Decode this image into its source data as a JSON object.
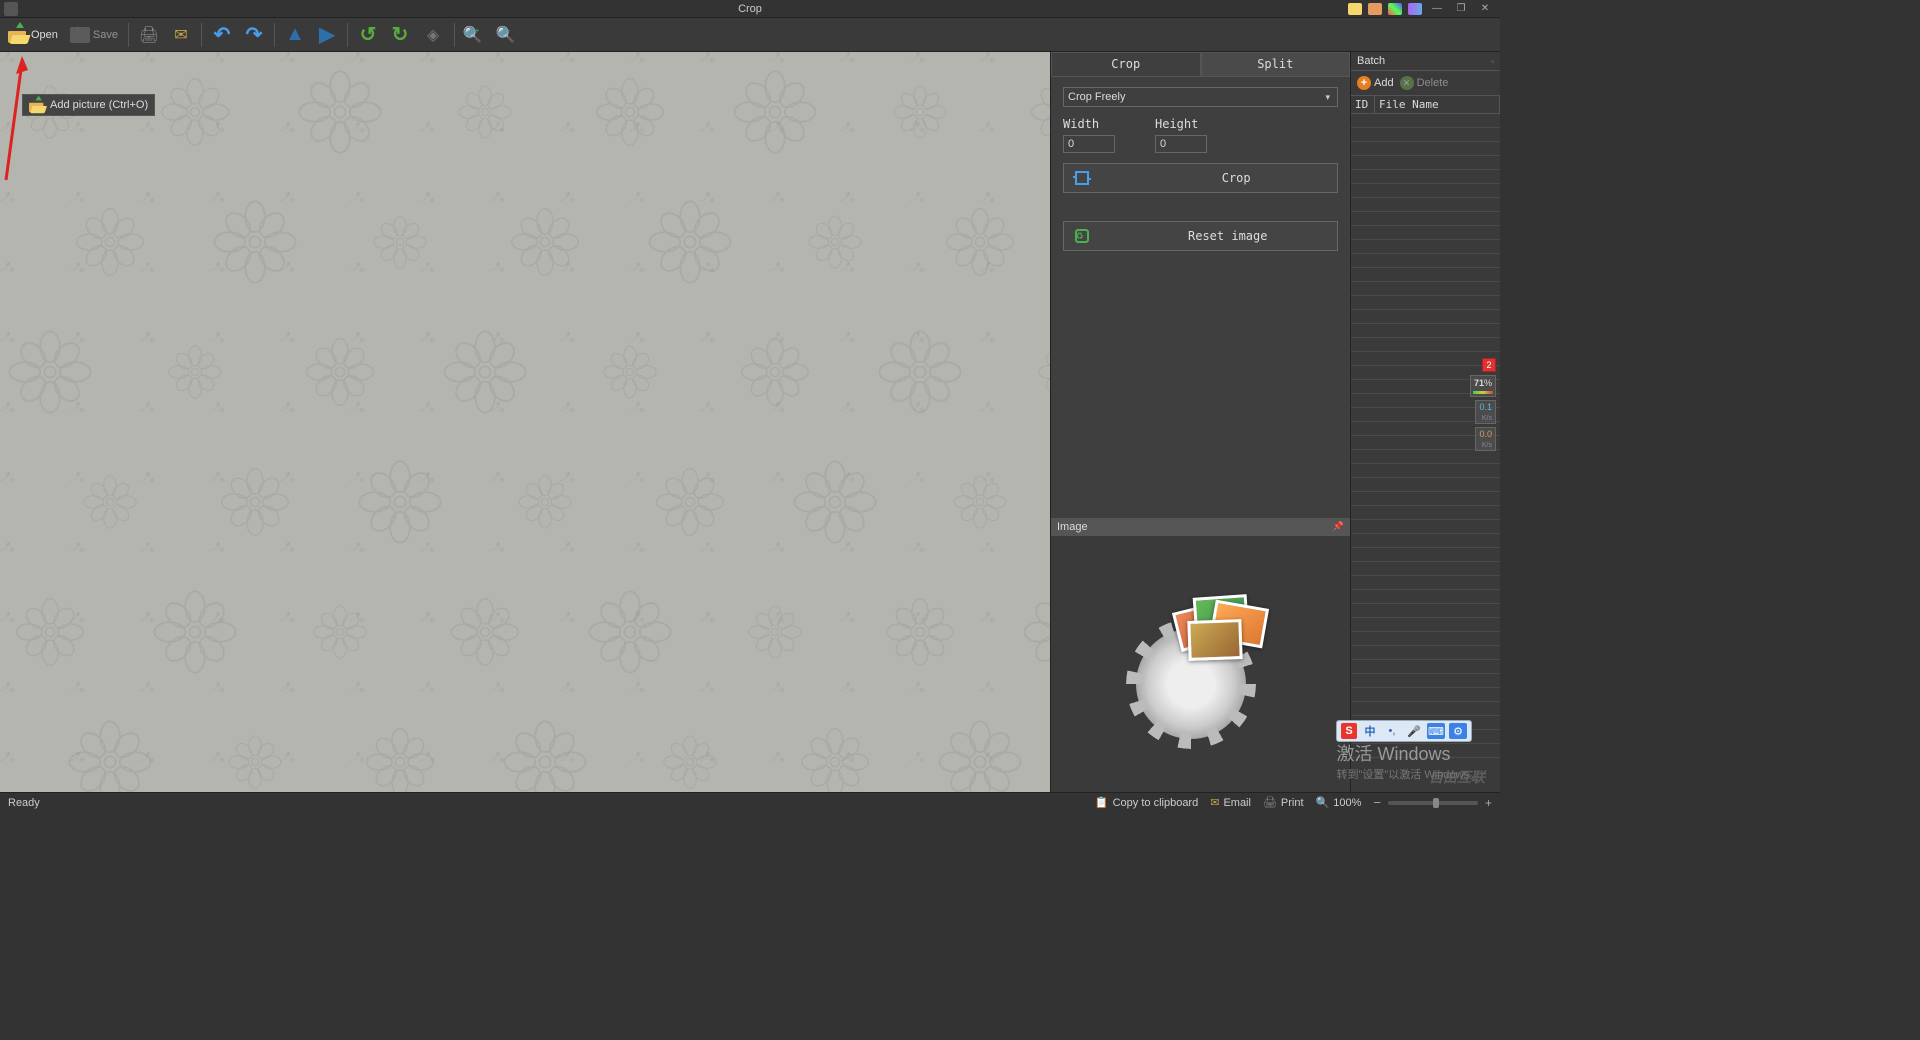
{
  "title": "Crop",
  "toolbar": {
    "open_label": "Open",
    "save_label": "Save"
  },
  "tooltip": {
    "text": "Add picture (Ctrl+O)"
  },
  "panel": {
    "tabs": {
      "crop": "Crop",
      "split": "Split"
    },
    "mode_select": "Crop Freely",
    "width_label": "Width",
    "height_label": "Height",
    "width_value": "0",
    "height_value": "0",
    "crop_btn": "Crop",
    "reset_btn": "Reset image"
  },
  "image_panel": {
    "header": "Image"
  },
  "batch": {
    "header": "Batch",
    "add_label": "Add",
    "delete_label": "Delete",
    "col_id": "ID",
    "col_file": "File Name"
  },
  "side": {
    "badge": "2",
    "pct": "71",
    "up": "0.1",
    "down": "0.0",
    "unit": "K/s"
  },
  "ime": {
    "logo": "S",
    "lang": "中"
  },
  "statusbar": {
    "ready": "Ready",
    "clip": "Copy to clipboard",
    "email": "Email",
    "print": "Print",
    "zoom": "100%"
  },
  "watermark": {
    "line1": "激活 Windows",
    "line2": "转到\"设置\"以激活 Windows。",
    "brand": "自由互联"
  }
}
